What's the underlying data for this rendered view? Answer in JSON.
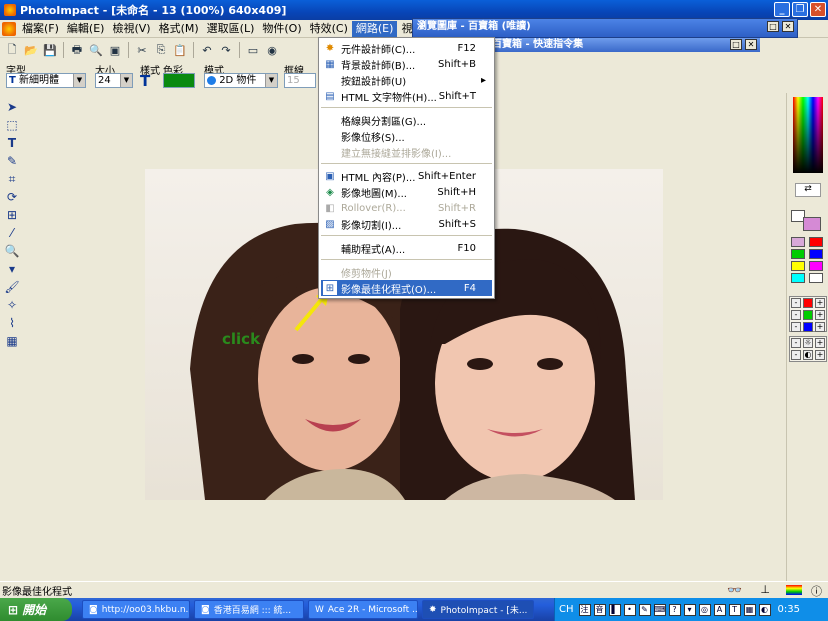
{
  "window": {
    "title": "PhotoImpact - [未命名 - 13 (100%) 640x409]"
  },
  "menubar": [
    "檔案(F)",
    "編輯(E)",
    "檢視(V)",
    "格式(M)",
    "選取區(L)",
    "物件(O)",
    "特效(C)",
    "網路(E)",
    "視窗(W)"
  ],
  "attr": {
    "font_label": "字型",
    "font_value": "新細明體",
    "size_label": "大小",
    "size_value": "24",
    "style_label": "樣式",
    "color_label": "色彩",
    "mode_label": "模式",
    "mode_value": "2D 物件",
    "border_label": "框線",
    "border_value": "15"
  },
  "subwindow": {
    "title": "瀏覽圖庫 - 百寶箱 (唯讀)",
    "subtitle": "百寶箱 - 快速指令集"
  },
  "menu": {
    "items": [
      {
        "label": "元件設計師(C)...",
        "shortcut": "F12",
        "icon": "component-designer-icon",
        "state": "enabled"
      },
      {
        "label": "背景設計師(B)...",
        "shortcut": "Shift+B",
        "icon": "background-designer-icon",
        "state": "enabled"
      },
      {
        "label": "按鈕設計師(U)",
        "shortcut": "▸",
        "icon": "",
        "state": "enabled"
      },
      {
        "label": "HTML 文字物件(H)...",
        "shortcut": "Shift+T",
        "icon": "html-text-icon",
        "state": "enabled"
      },
      {
        "label": "格線與分割區(G)...",
        "shortcut": "",
        "icon": "",
        "state": "enabled"
      },
      {
        "label": "影像位移(S)...",
        "shortcut": "",
        "icon": "",
        "state": "enabled"
      },
      {
        "label": "建立無接縫並排影像(I)...",
        "shortcut": "",
        "icon": "",
        "state": "disabled"
      },
      {
        "label": "HTML 內容(P)...",
        "shortcut": "Shift+Enter",
        "icon": "html-properties-icon",
        "state": "enabled"
      },
      {
        "label": "影像地圖(M)...",
        "shortcut": "Shift+H",
        "icon": "image-map-icon",
        "state": "enabled"
      },
      {
        "label": "Rollover(R)...",
        "shortcut": "Shift+R",
        "icon": "rollover-icon",
        "state": "disabled"
      },
      {
        "label": "影像切割(I)...",
        "shortcut": "Shift+S",
        "icon": "image-slicer-icon",
        "state": "enabled"
      },
      {
        "label": "輔助程式(A)...",
        "shortcut": "F10",
        "icon": "",
        "state": "enabled"
      },
      {
        "label": "修剪物件(J)",
        "shortcut": "",
        "icon": "",
        "state": "disabled"
      },
      {
        "label": "影像最佳化程式(O)...",
        "shortcut": "F4",
        "icon": "image-optimizer-icon",
        "state": "highlighted"
      }
    ]
  },
  "annotation": "click",
  "status": "影像最佳化程式",
  "taskbar": {
    "start": "開始",
    "tasks": [
      "http://oo03.hkbu.n...",
      "香港百易網 ::: 統...",
      "Ace 2R - Microsoft ...",
      "PhotoImpact - [未..."
    ],
    "lang": "CH",
    "clock": "0:35"
  },
  "colors": {
    "accent": "#316ac5",
    "title_blue": "#0a5fd8",
    "annotation": "#2a8a1c",
    "arrow": "#f5e60a"
  }
}
